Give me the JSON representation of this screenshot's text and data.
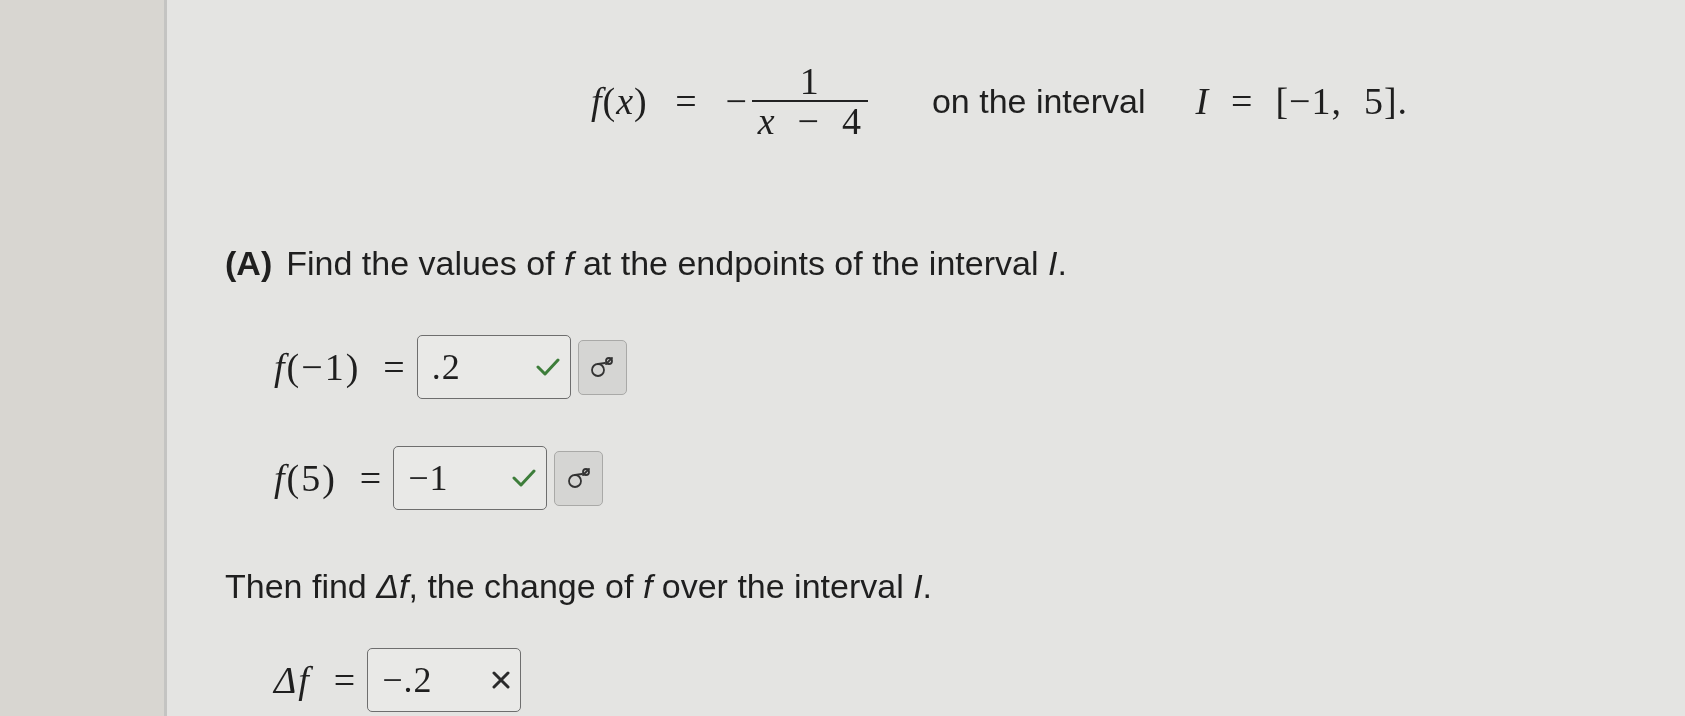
{
  "formula": {
    "lhs": "*f*(*x*) = −",
    "numerator": "1",
    "denominator": "*x* − 4",
    "connector": "on the interval",
    "interval": "*I* = [−1, 5]."
  },
  "part_a": {
    "label": "(A)",
    "prompt": "Find the values of *f* at the endpoints of the interval *I*.",
    "answers": [
      {
        "label": "*f*(−1) =",
        "value": ".2",
        "correct": true,
        "symbol_button": true
      },
      {
        "label": "*f*(5) =",
        "value": "−1",
        "correct": true,
        "symbol_button": true
      }
    ],
    "followup": "Then find *Δf*, the change of *f* over the interval *I*.",
    "followup_answers": [
      {
        "label": "*Δf* =",
        "value": "−.2",
        "correct": false
      }
    ]
  }
}
